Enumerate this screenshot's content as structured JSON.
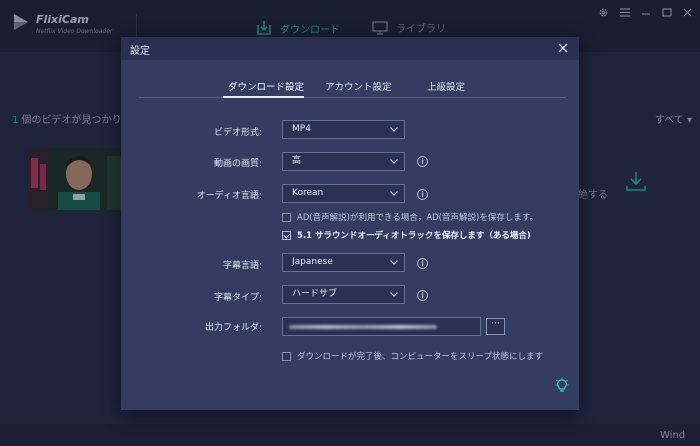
{
  "app": {
    "name": "FlixiCam",
    "subtitle": "Netflix Video Downloader",
    "tabs": [
      {
        "label": "ダウンロード",
        "active": true
      },
      {
        "label": "ライブラリ",
        "active": false
      }
    ],
    "accent_color": "#2ec4b6"
  },
  "background": {
    "video_count_number": "1",
    "video_count_text": " 個のビデオが見つかりまし",
    "sort_label": "すべて ▾",
    "extra_text": "絶する",
    "bottom_text": "Wind"
  },
  "dialog": {
    "title": "設定",
    "tabs": [
      {
        "label": "ダウンロード設定",
        "active": true
      },
      {
        "label": "アカウント設定",
        "active": false
      },
      {
        "label": "上級設定",
        "active": false
      }
    ],
    "video_format": {
      "label": "ビデオ形式:",
      "value": "MP4"
    },
    "video_quality": {
      "label": "動画の画質:",
      "value": "高"
    },
    "audio_language": {
      "label": "オーディオ言語:",
      "value": "Korean"
    },
    "ad_option": {
      "label": "AD(音声解説)が利用できる場合，AD(音声解説)を保存します。",
      "checked": false
    },
    "surround_option": {
      "label": "5.1 サラウンドオーディオトラックを保存します（ある場合)",
      "checked": true
    },
    "subtitle_language": {
      "label": "字幕言語:",
      "value": "Japanese"
    },
    "subtitle_type": {
      "label": "字幕タイプ:",
      "value": "ハードサブ"
    },
    "output_folder": {
      "label": "出力フォルダ:",
      "browse_label": "···"
    },
    "sleep_option": {
      "label": "ダウンロードが完了後、コンピューターをスリープ状態にします",
      "checked": false
    }
  }
}
